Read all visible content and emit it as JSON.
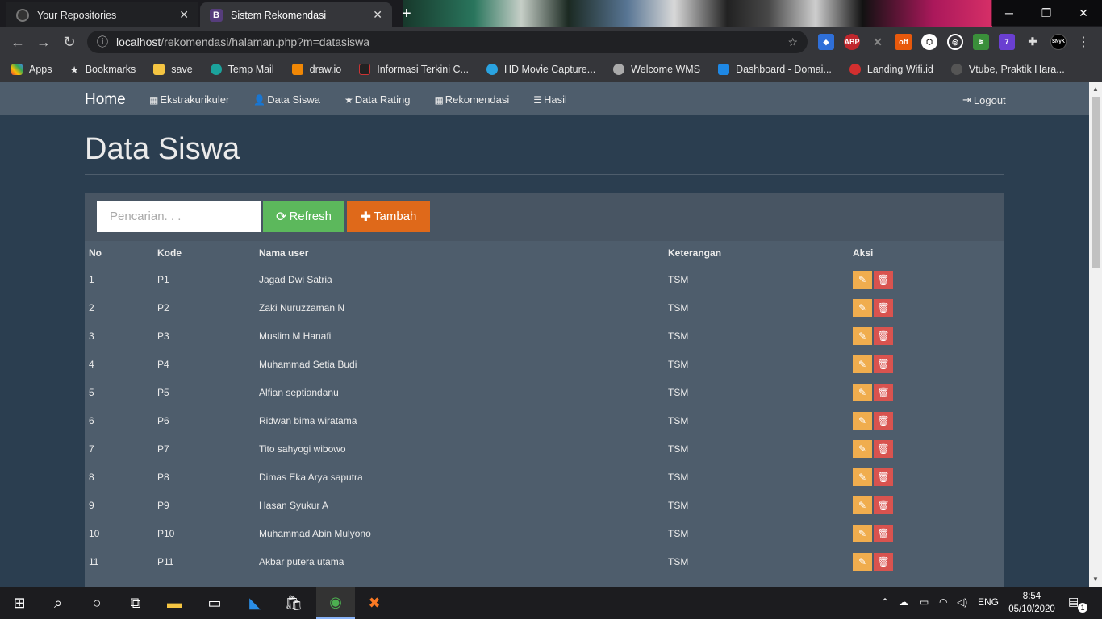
{
  "browser": {
    "tabs": [
      {
        "title": "Your Repositories",
        "active": false
      },
      {
        "title": "Sistem Rekomendasi",
        "active": true,
        "favicon_text": "B"
      }
    ],
    "url_host": "localhost",
    "url_path": "/rekomendasi/halaman.php?m=datasiswa",
    "bookmarks": [
      "Apps",
      "Bookmarks",
      "save",
      "Temp Mail",
      "draw.io",
      "Informasi Terkini C...",
      "HD Movie Capture...",
      "Welcome WMS",
      "Dashboard - Domai...",
      "Landing Wifi.id",
      "Vtube, Praktik Hara..."
    ],
    "extensions": {
      "abp": "ABP",
      "off": "off",
      "badge": "7",
      "synk": "SNyK"
    }
  },
  "navbar": {
    "brand": "Home",
    "items": [
      {
        "label": "Ekstrakurikuler",
        "icon": "grid-icon"
      },
      {
        "label": "Data Siswa",
        "icon": "user-icon"
      },
      {
        "label": "Data Rating",
        "icon": "star-icon"
      },
      {
        "label": "Rekomendasi",
        "icon": "calendar-icon"
      },
      {
        "label": "Hasil",
        "icon": "list-icon"
      }
    ],
    "logout": "Logout"
  },
  "page": {
    "title": "Data Siswa",
    "search_placeholder": "Pencarian. . .",
    "refresh_label": "Refresh",
    "add_label": "Tambah"
  },
  "table": {
    "headers": [
      "No",
      "Kode",
      "Nama user",
      "Keterangan",
      "Aksi"
    ],
    "rows": [
      {
        "no": "1",
        "kode": "P1",
        "nama": "Jagad Dwi Satria",
        "ket": "TSM"
      },
      {
        "no": "2",
        "kode": "P2",
        "nama": "Zaki Nuruzzaman N",
        "ket": "TSM"
      },
      {
        "no": "3",
        "kode": "P3",
        "nama": "Muslim M Hanafi",
        "ket": "TSM"
      },
      {
        "no": "4",
        "kode": "P4",
        "nama": "Muhammad Setia Budi",
        "ket": "TSM"
      },
      {
        "no": "5",
        "kode": "P5",
        "nama": "Alfian septiandanu",
        "ket": "TSM"
      },
      {
        "no": "6",
        "kode": "P6",
        "nama": "Ridwan bima wiratama",
        "ket": "TSM"
      },
      {
        "no": "7",
        "kode": "P7",
        "nama": "Tito sahyogi wibowo",
        "ket": "TSM"
      },
      {
        "no": "8",
        "kode": "P8",
        "nama": "Dimas Eka Arya saputra",
        "ket": "TSM"
      },
      {
        "no": "9",
        "kode": "P9",
        "nama": "Hasan Syukur A",
        "ket": "TSM"
      },
      {
        "no": "10",
        "kode": "P10",
        "nama": "Muhammad Abin Mulyono",
        "ket": "TSM"
      },
      {
        "no": "11",
        "kode": "P11",
        "nama": "Akbar putera utama",
        "ket": "TSM"
      }
    ]
  },
  "taskbar": {
    "language": "ENG",
    "time": "8:54",
    "date": "05/10/2020",
    "notifications": "1"
  },
  "colors": {
    "page_bg": "#2b3e50",
    "navbar_bg": "#4e5d6c",
    "refresh": "#5cb85c",
    "add": "#df691a",
    "edit": "#f0ad4e",
    "delete": "#d9534f"
  }
}
